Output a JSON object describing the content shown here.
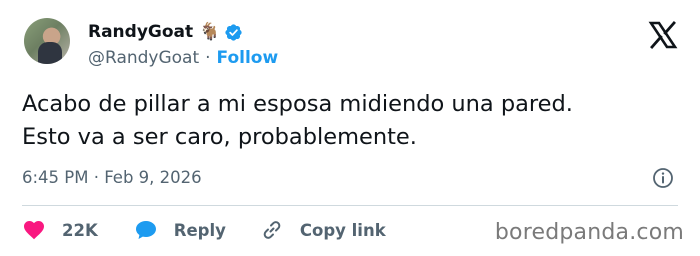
{
  "author": {
    "display_name": "RandyGoat",
    "emoji": "🐐",
    "handle": "@RandyGoat",
    "separator": "·",
    "follow_label": "Follow"
  },
  "tweet": {
    "lines": [
      "Acabo de pillar a mi esposa midiendo una pared.",
      "Esto va a ser caro, probablemente."
    ],
    "timestamp": "6:45 PM · Feb 9, 2026"
  },
  "actions": {
    "likes_count": "22K",
    "reply_label": "Reply",
    "copy_link_label": "Copy link"
  },
  "icons": {
    "verified": "verified-badge-icon",
    "platform": "x-logo-icon",
    "info": "info-icon",
    "like": "heart-icon",
    "reply": "speech-bubble-icon",
    "copy": "link-icon"
  },
  "colors": {
    "accent": "#1d9bf0",
    "like": "#f91880",
    "secondary_text": "#536471",
    "divider": "#cfd9de"
  },
  "watermark": "boredpanda.com"
}
